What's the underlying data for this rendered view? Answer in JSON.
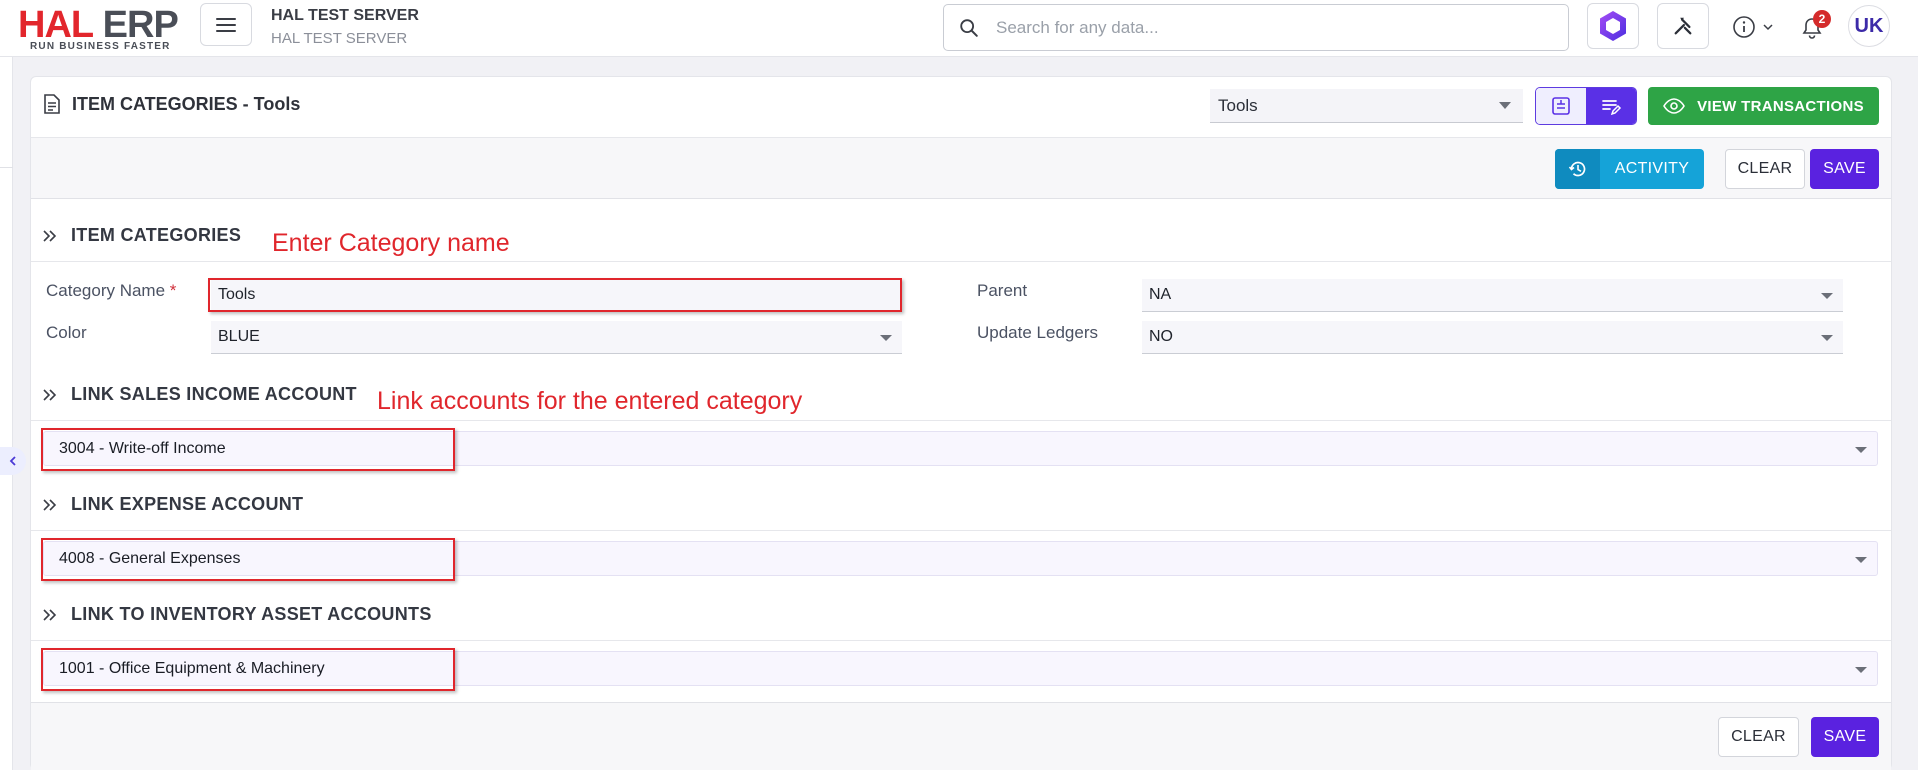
{
  "app": {
    "logo_main": "HAL",
    "logo_second": "ERP",
    "logo_tagline": "RUN BUSINESS FASTER",
    "server_title": "HAL TEST SERVER",
    "server_subtitle": "HAL TEST SERVER",
    "search_placeholder": "Search for any data...",
    "notification_count": "2",
    "user_initials": "UK"
  },
  "page": {
    "title": "ITEM CATEGORIES - Tools",
    "record_selector_value": "Tools",
    "view_transactions_label": "VIEW TRANSACTIONS",
    "activity_label": "ACTIVITY",
    "clear_label": "CLEAR",
    "save_label": "SAVE"
  },
  "sections": {
    "item_categories": "ITEM CATEGORIES",
    "sales_income": "LINK SALES INCOME ACCOUNT",
    "expense": "LINK EXPENSE ACCOUNT",
    "inventory_asset": "LINK TO INVENTORY ASSET ACCOUNTS"
  },
  "form": {
    "category_name_label": "Category Name",
    "required_marker": "*",
    "category_name_value": "Tools",
    "color_label": "Color",
    "color_value": "BLUE",
    "parent_label": "Parent",
    "parent_value": "NA",
    "update_ledgers_label": "Update Ledgers",
    "update_ledgers_value": "NO"
  },
  "accounts": {
    "sales_income": "3004 - Write-off Income",
    "expense": "4008 - General Expenses",
    "inventory_asset": "1001 - Office Equipment & Machinery"
  },
  "annotations": {
    "category_hint": "Enter Category name",
    "accounts_hint": "Link accounts for the entered category"
  },
  "colors": {
    "brand_red": "#e2262c",
    "primary_purple": "#5a22e0",
    "success_green": "#2ea446",
    "info_blue": "#15a3d8",
    "annotation_red": "#e0262c"
  },
  "icons": [
    "hamburger-menu-icon",
    "search-icon",
    "hexagon-app-icon",
    "tools-icon",
    "info-icon",
    "chevron-down-icon",
    "bell-icon",
    "document-icon",
    "add-note-icon",
    "edit-list-icon",
    "eye-icon",
    "history-icon",
    "double-chevron-right-icon",
    "chevron-left-icon"
  ]
}
